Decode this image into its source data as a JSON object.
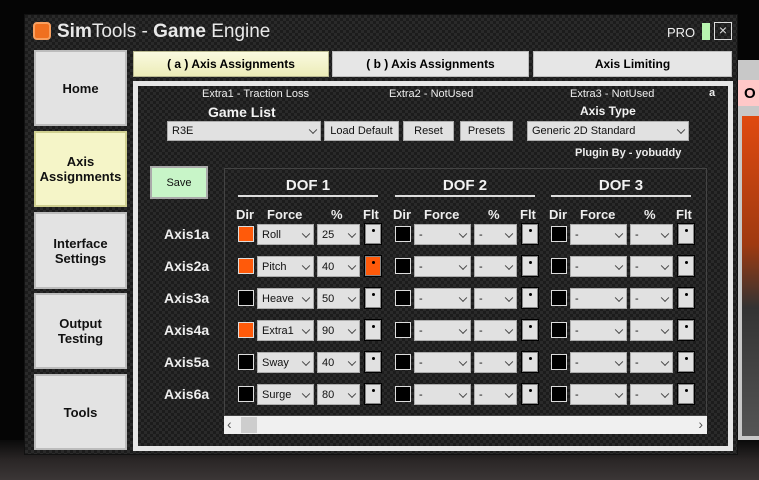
{
  "window": {
    "title_bold1": "Sim",
    "title_reg1": "Tools - ",
    "title_bold2": "Game",
    "title_reg2": " Engine",
    "edition": "PRO",
    "close": "×"
  },
  "sidebar": {
    "items": [
      {
        "label": "Home"
      },
      {
        "label": "Axis Assignments",
        "active": true
      },
      {
        "label": "Interface Settings"
      },
      {
        "label": "Output Testing"
      },
      {
        "label": "Tools"
      }
    ]
  },
  "tabs": [
    {
      "label": "( a ) Axis Assignments",
      "active": true
    },
    {
      "label": "( b ) Axis Assignments"
    },
    {
      "label": "Axis Limiting"
    }
  ],
  "extras": {
    "extra1": "Extra1 - Traction Loss",
    "extra2": "Extra2 - NotUsed",
    "extra3": "Extra3 - NotUsed",
    "corner": "a"
  },
  "game_list": {
    "label": "Game List",
    "value": "R3E"
  },
  "buttons": {
    "load_default": "Load Default",
    "reset": "Reset",
    "presets": "Presets",
    "save": "Save"
  },
  "axis_type": {
    "label": "Axis Type",
    "value": "Generic 2D Standard"
  },
  "plugin_by": "Plugin By - yobuddy",
  "dof_headers": [
    "DOF 1",
    "DOF 2",
    "DOF 3"
  ],
  "col_headers": {
    "dir": "Dir",
    "force": "Force",
    "pct": "%",
    "flt": "Flt"
  },
  "axes": [
    {
      "name": "Axis1a",
      "dof": [
        {
          "dir": true,
          "force": "Roll",
          "pct": "25",
          "flt": false
        },
        {
          "dir": false,
          "force": "-",
          "pct": "-",
          "flt": false
        },
        {
          "dir": false,
          "force": "-",
          "pct": "-",
          "flt": false
        }
      ]
    },
    {
      "name": "Axis2a",
      "dof": [
        {
          "dir": true,
          "force": "Pitch",
          "pct": "40",
          "flt": true
        },
        {
          "dir": false,
          "force": "-",
          "pct": "-",
          "flt": false
        },
        {
          "dir": false,
          "force": "-",
          "pct": "-",
          "flt": false
        }
      ]
    },
    {
      "name": "Axis3a",
      "dof": [
        {
          "dir": false,
          "force": "Heave",
          "pct": "50",
          "flt": false
        },
        {
          "dir": false,
          "force": "-",
          "pct": "-",
          "flt": false
        },
        {
          "dir": false,
          "force": "-",
          "pct": "-",
          "flt": false
        }
      ]
    },
    {
      "name": "Axis4a",
      "dof": [
        {
          "dir": true,
          "force": "Extra1",
          "pct": "90",
          "flt": false
        },
        {
          "dir": false,
          "force": "-",
          "pct": "-",
          "flt": false
        },
        {
          "dir": false,
          "force": "-",
          "pct": "-",
          "flt": false
        }
      ]
    },
    {
      "name": "Axis5a",
      "dof": [
        {
          "dir": false,
          "force": "Sway",
          "pct": "40",
          "flt": false
        },
        {
          "dir": false,
          "force": "-",
          "pct": "-",
          "flt": false
        },
        {
          "dir": false,
          "force": "-",
          "pct": "-",
          "flt": false
        }
      ]
    },
    {
      "name": "Axis6a",
      "dof": [
        {
          "dir": false,
          "force": "Surge",
          "pct": "80",
          "flt": false
        },
        {
          "dir": false,
          "force": "-",
          "pct": "-",
          "flt": false
        },
        {
          "dir": false,
          "force": "-",
          "pct": "-",
          "flt": false
        }
      ]
    }
  ],
  "scrollbar": {
    "left": "‹",
    "right": "›"
  },
  "background_window": {
    "label": "O"
  },
  "colors": {
    "accent": "#ff5a0a",
    "save_bg": "#c8f5c8",
    "active_tab": "#f5f5c8"
  }
}
